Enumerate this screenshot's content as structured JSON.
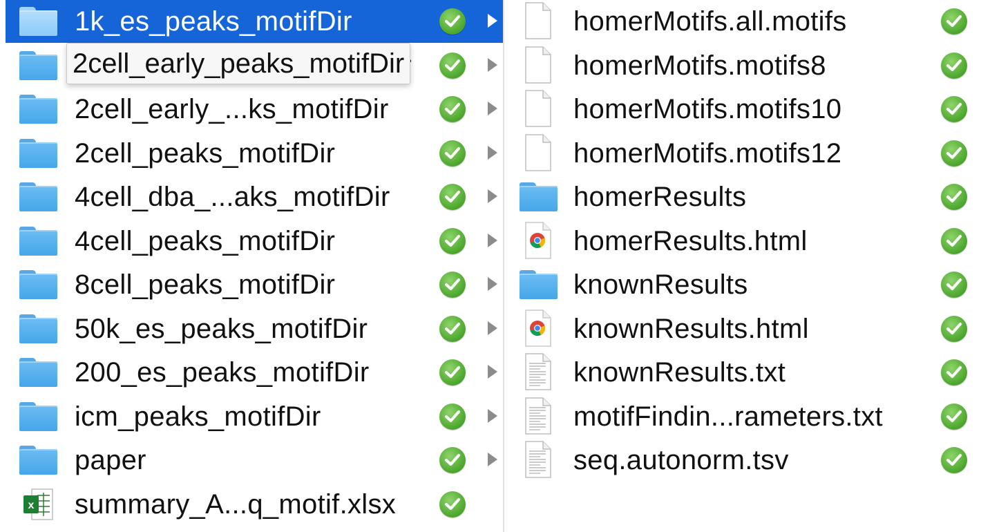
{
  "left_column": {
    "items": [
      {
        "name": "1k_es_peaks_motifDir",
        "type": "folder",
        "selected": true
      },
      {
        "name": "2cell_early_peaks_motifDir",
        "type": "folder"
      },
      {
        "name": "2cell_early_...ks_motifDir",
        "type": "folder"
      },
      {
        "name": "2cell_peaks_motifDir",
        "type": "folder"
      },
      {
        "name": "4cell_dba_...aks_motifDir",
        "type": "folder"
      },
      {
        "name": "4cell_peaks_motifDir",
        "type": "folder"
      },
      {
        "name": "8cell_peaks_motifDir",
        "type": "folder"
      },
      {
        "name": "50k_es_peaks_motifDir",
        "type": "folder"
      },
      {
        "name": "200_es_peaks_motifDir",
        "type": "folder"
      },
      {
        "name": "icm_peaks_motifDir",
        "type": "folder"
      },
      {
        "name": "paper",
        "type": "folder"
      },
      {
        "name": "summary_A...q_motif.xlsx",
        "type": "excel"
      }
    ],
    "tooltip": "2cell_early_peaks_motifDir"
  },
  "right_column": {
    "items": [
      {
        "name": "homerMotifs.all.motifs",
        "type": "document"
      },
      {
        "name": "homerMotifs.motifs8",
        "type": "document"
      },
      {
        "name": "homerMotifs.motifs10",
        "type": "document"
      },
      {
        "name": "homerMotifs.motifs12",
        "type": "document"
      },
      {
        "name": "homerResults",
        "type": "folder"
      },
      {
        "name": "homerResults.html",
        "type": "chrome"
      },
      {
        "name": "knownResults",
        "type": "folder"
      },
      {
        "name": "knownResults.html",
        "type": "chrome"
      },
      {
        "name": "knownResults.txt",
        "type": "text"
      },
      {
        "name": "motifFindin...rameters.txt",
        "type": "text"
      },
      {
        "name": "seq.autonorm.tsv",
        "type": "text"
      }
    ]
  },
  "colors": {
    "selection": "#1565d9",
    "folder": "#5bb0ee",
    "sync_check": "#4ba62c"
  },
  "icons": {
    "folder": "folder-icon",
    "document": "document-icon",
    "text": "text-document-icon",
    "chrome": "chrome-html-icon",
    "excel": "excel-icon",
    "sync": "sync-check-icon",
    "chevron": "chevron-right-icon"
  }
}
